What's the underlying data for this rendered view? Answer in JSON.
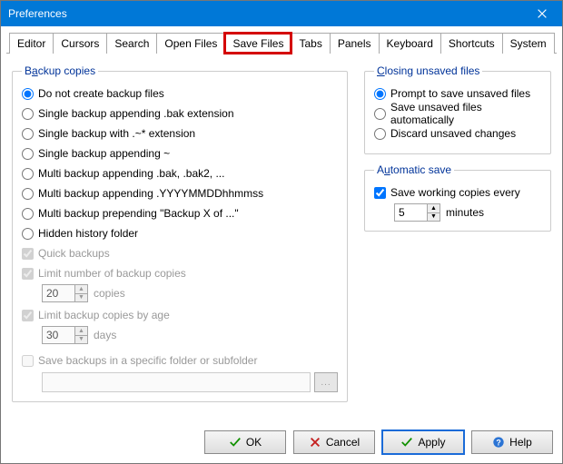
{
  "title": "Preferences",
  "tabs": [
    "Editor",
    "Cursors",
    "Search",
    "Open Files",
    "Save Files",
    "Tabs",
    "Panels",
    "Keyboard",
    "Shortcuts",
    "System"
  ],
  "activeTab": "Save Files",
  "groups": {
    "backup": {
      "legend_pre": "B",
      "legend_ul": "a",
      "legend_post": "ckup copies",
      "options": [
        "Do not create backup files",
        "Single backup appending .bak extension",
        "Single backup with .~* extension",
        "Single backup appending ~",
        "Multi backup appending .bak, .bak2, ...",
        "Multi backup appending .YYYYMMDDhhmmss",
        "Multi backup prepending \"Backup X of ...\"",
        "Hidden history folder"
      ],
      "selected": 0,
      "quick": "Quick backups",
      "limit_num": "Limit number of backup copies",
      "limit_num_val": "20",
      "limit_num_unit": "copies",
      "limit_age": "Limit backup copies by age",
      "limit_age_val": "30",
      "limit_age_unit": "days",
      "specific": "Save backups in a specific folder or subfolder",
      "specific_val": ""
    },
    "closing": {
      "legend_ul": "C",
      "legend_post": "losing unsaved files",
      "options": [
        "Prompt to save unsaved files",
        "Save unsaved files automatically",
        "Discard unsaved changes"
      ],
      "selected": 0
    },
    "auto": {
      "legend_pre": "A",
      "legend_ul": "u",
      "legend_post": "tomatic save",
      "label": "Save working copies every",
      "val": "5",
      "unit": "minutes",
      "checked": true
    }
  },
  "buttons": {
    "ok": "OK",
    "cancel": "Cancel",
    "apply": "Apply",
    "help": "Help"
  }
}
